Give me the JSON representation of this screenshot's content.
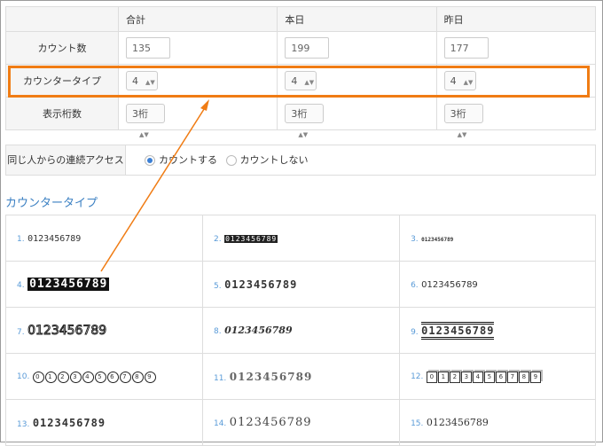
{
  "settings": {
    "columns": [
      "合計",
      "本日",
      "昨日"
    ],
    "rows": {
      "count": {
        "label": "カウント数",
        "values": [
          "135",
          "199",
          "177"
        ]
      },
      "counter_type": {
        "label": "カウンタータイプ",
        "values": [
          "4",
          "4",
          "4"
        ]
      },
      "digits": {
        "label": "表示桁数",
        "values": [
          "3桁",
          "3桁",
          "3桁"
        ]
      }
    }
  },
  "access": {
    "label": "同じ人からの連続アクセス",
    "options": [
      {
        "label": "カウントする",
        "selected": true
      },
      {
        "label": "カウントしない",
        "selected": false
      }
    ]
  },
  "counter_types": {
    "title": "カウンタータイプ",
    "items": [
      {
        "num": "1.",
        "sample": "0123456789"
      },
      {
        "num": "2.",
        "sample": "0123456789"
      },
      {
        "num": "3.",
        "sample": "0123456789"
      },
      {
        "num": "4.",
        "sample": "0123456789"
      },
      {
        "num": "5.",
        "sample": "0123456789"
      },
      {
        "num": "6.",
        "sample": "0123456789"
      },
      {
        "num": "7.",
        "sample": "0123456789"
      },
      {
        "num": "8.",
        "sample": "0123456789"
      },
      {
        "num": "9.",
        "sample": "0123456789"
      },
      {
        "num": "10.",
        "sample": "0123456789"
      },
      {
        "num": "11.",
        "sample": "0123456789"
      },
      {
        "num": "12.",
        "sample": "0123456789"
      },
      {
        "num": "13.",
        "sample": "0123456789"
      },
      {
        "num": "14.",
        "sample": "0123456789"
      },
      {
        "num": "15.",
        "sample": "0123456789"
      }
    ]
  },
  "colors": {
    "highlight": "#f07c14",
    "accent": "#3a7fc2",
    "radio_selected": "#3b7fd4"
  }
}
